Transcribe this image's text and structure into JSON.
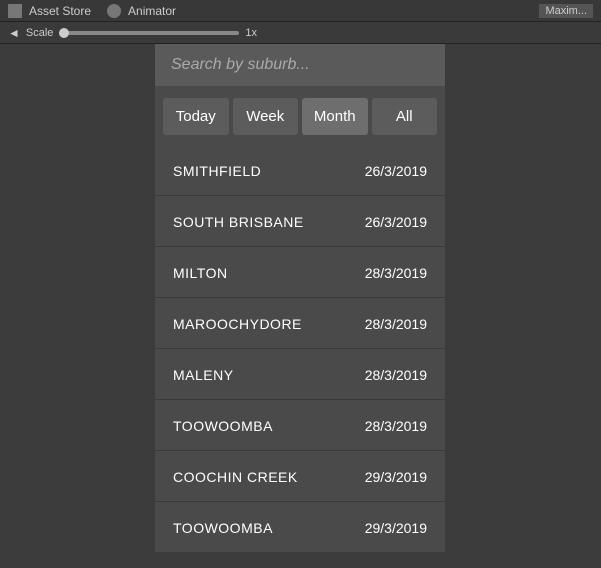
{
  "toolbar": {
    "asset_store_label": "Asset Store",
    "animator_label": "Animator",
    "asset_store_icon": "grid-icon",
    "animator_icon": "person-icon"
  },
  "scale_bar": {
    "arrow_label": "◄",
    "scale_label": "Scale",
    "scale_value": "1x",
    "maximize_label": "Maxim..."
  },
  "search": {
    "placeholder": "Search by suburb..."
  },
  "filter_tabs": [
    {
      "label": "Today",
      "active": false
    },
    {
      "label": "Week",
      "active": false
    },
    {
      "label": "Month",
      "active": true
    },
    {
      "label": "All",
      "active": false
    }
  ],
  "list_items": [
    {
      "suburb": "SMITHFIELD",
      "date": "26/3/2019"
    },
    {
      "suburb": "SOUTH BRISBANE",
      "date": "26/3/2019"
    },
    {
      "suburb": "MILTON",
      "date": "28/3/2019"
    },
    {
      "suburb": "MAROOCHYDORE",
      "date": "28/3/2019"
    },
    {
      "suburb": "MALENY",
      "date": "28/3/2019"
    },
    {
      "suburb": "TOOWOOMBA",
      "date": "28/3/2019"
    },
    {
      "suburb": "COOCHIN CREEK",
      "date": "29/3/2019"
    },
    {
      "suburb": "TOOWOOMBA",
      "date": "29/3/2019"
    }
  ]
}
